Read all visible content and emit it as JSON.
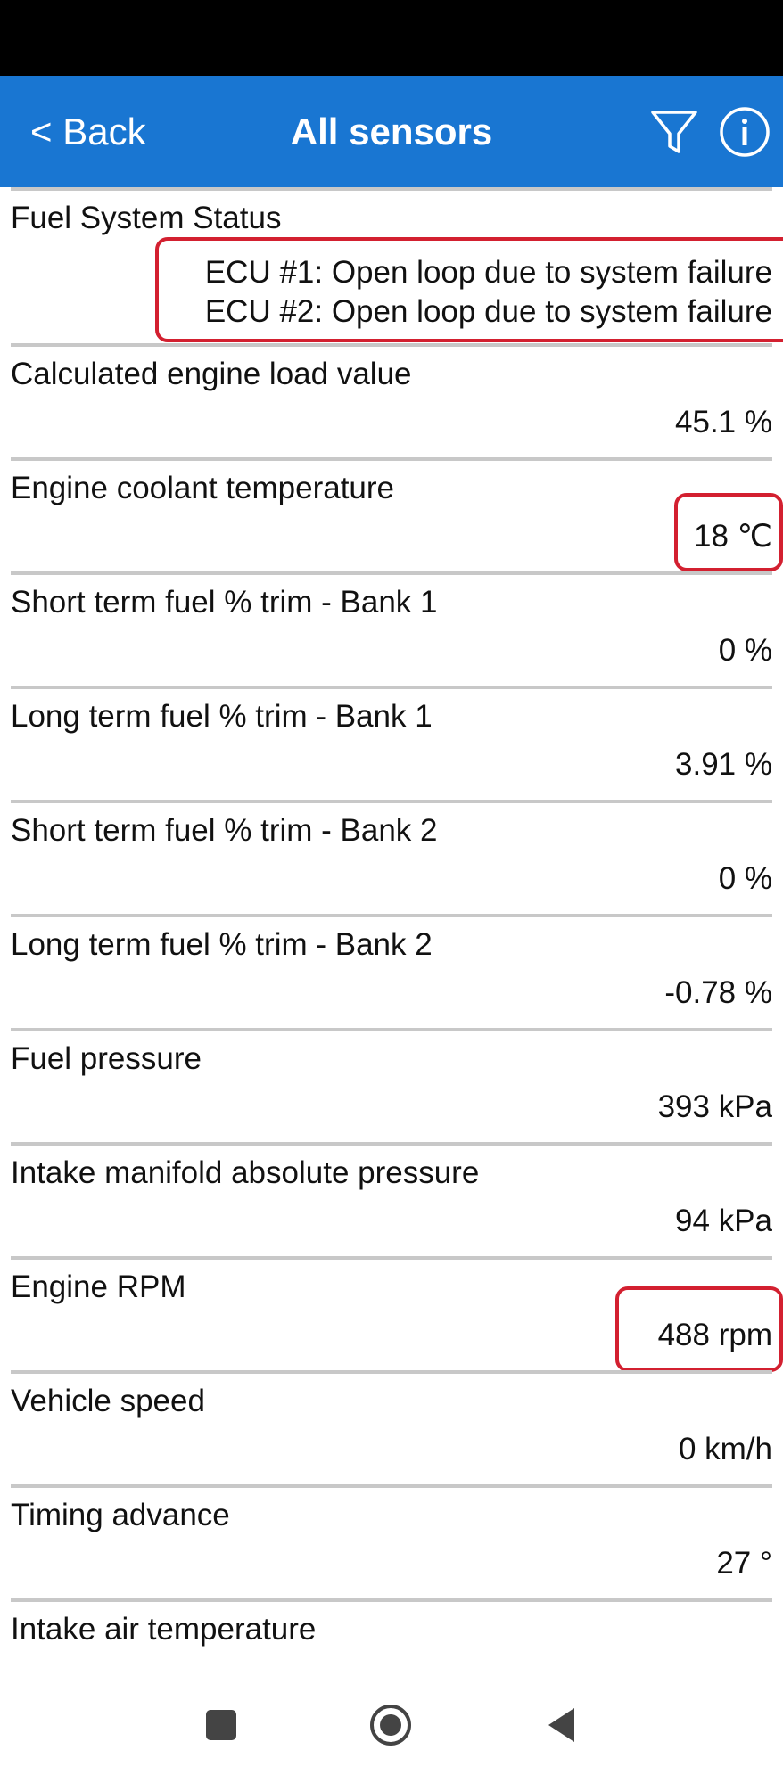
{
  "app_bar": {
    "back_label": "< Back",
    "title": "All sensors",
    "filter_icon": "filter-funnel",
    "info_icon": "info-circle",
    "color": "#1976d2"
  },
  "sensors": [
    {
      "name": "Fuel System Status",
      "value_lines": [
        "ECU #1: Open loop due to system failure",
        "ECU #2: Open loop due to system failure"
      ],
      "highlighted": true
    },
    {
      "name": "Calculated engine load value",
      "value": "45.1 %"
    },
    {
      "name": "Engine coolant temperature",
      "value": "18 ℃",
      "highlighted": true
    },
    {
      "name": "Short term fuel % trim - Bank 1",
      "value": "0 %"
    },
    {
      "name": "Long term fuel % trim - Bank 1",
      "value": "3.91 %"
    },
    {
      "name": "Short term fuel % trim - Bank 2",
      "value": "0 %"
    },
    {
      "name": "Long term fuel % trim - Bank 2",
      "value": "-0.78 %"
    },
    {
      "name": "Fuel pressure",
      "value": "393 kPa"
    },
    {
      "name": "Intake manifold absolute pressure",
      "value": "94 kPa"
    },
    {
      "name": "Engine RPM",
      "value": "488 rpm",
      "highlighted": true
    },
    {
      "name": "Vehicle speed",
      "value": "0 km/h"
    },
    {
      "name": "Timing advance",
      "value": "27 °"
    },
    {
      "name": "Intake air temperature",
      "value": ""
    }
  ],
  "highlight_color": "#d32030",
  "nav_bar": {
    "recents_icon": "square-recents",
    "home_icon": "circle-home",
    "back_icon": "triangle-back"
  }
}
